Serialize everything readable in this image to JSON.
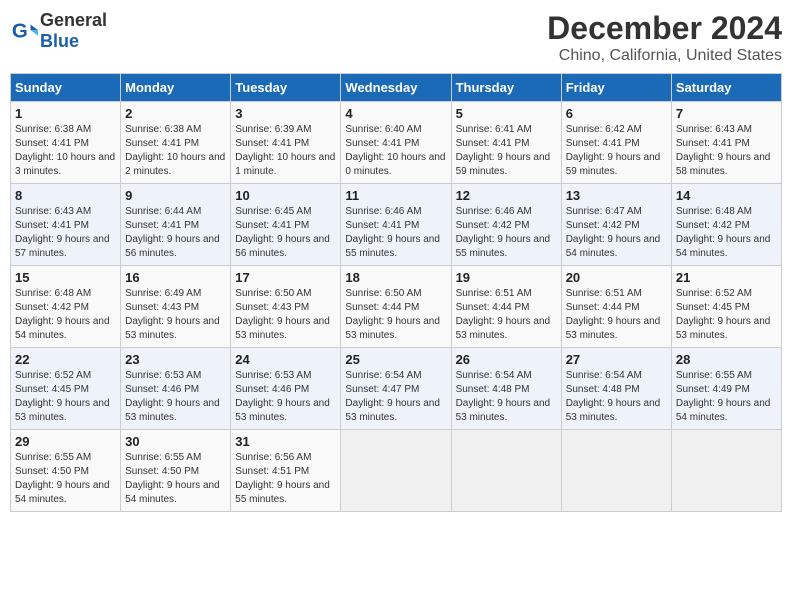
{
  "header": {
    "logo_general": "General",
    "logo_blue": "Blue",
    "month_title": "December 2024",
    "location": "Chino, California, United States"
  },
  "columns": [
    "Sunday",
    "Monday",
    "Tuesday",
    "Wednesday",
    "Thursday",
    "Friday",
    "Saturday"
  ],
  "weeks": [
    [
      {
        "day": "1",
        "sunrise": "Sunrise: 6:38 AM",
        "sunset": "Sunset: 4:41 PM",
        "daylight": "Daylight: 10 hours and 3 minutes."
      },
      {
        "day": "2",
        "sunrise": "Sunrise: 6:38 AM",
        "sunset": "Sunset: 4:41 PM",
        "daylight": "Daylight: 10 hours and 2 minutes."
      },
      {
        "day": "3",
        "sunrise": "Sunrise: 6:39 AM",
        "sunset": "Sunset: 4:41 PM",
        "daylight": "Daylight: 10 hours and 1 minute."
      },
      {
        "day": "4",
        "sunrise": "Sunrise: 6:40 AM",
        "sunset": "Sunset: 4:41 PM",
        "daylight": "Daylight: 10 hours and 0 minutes."
      },
      {
        "day": "5",
        "sunrise": "Sunrise: 6:41 AM",
        "sunset": "Sunset: 4:41 PM",
        "daylight": "Daylight: 9 hours and 59 minutes."
      },
      {
        "day": "6",
        "sunrise": "Sunrise: 6:42 AM",
        "sunset": "Sunset: 4:41 PM",
        "daylight": "Daylight: 9 hours and 59 minutes."
      },
      {
        "day": "7",
        "sunrise": "Sunrise: 6:43 AM",
        "sunset": "Sunset: 4:41 PM",
        "daylight": "Daylight: 9 hours and 58 minutes."
      }
    ],
    [
      {
        "day": "8",
        "sunrise": "Sunrise: 6:43 AM",
        "sunset": "Sunset: 4:41 PM",
        "daylight": "Daylight: 9 hours and 57 minutes."
      },
      {
        "day": "9",
        "sunrise": "Sunrise: 6:44 AM",
        "sunset": "Sunset: 4:41 PM",
        "daylight": "Daylight: 9 hours and 56 minutes."
      },
      {
        "day": "10",
        "sunrise": "Sunrise: 6:45 AM",
        "sunset": "Sunset: 4:41 PM",
        "daylight": "Daylight: 9 hours and 56 minutes."
      },
      {
        "day": "11",
        "sunrise": "Sunrise: 6:46 AM",
        "sunset": "Sunset: 4:41 PM",
        "daylight": "Daylight: 9 hours and 55 minutes."
      },
      {
        "day": "12",
        "sunrise": "Sunrise: 6:46 AM",
        "sunset": "Sunset: 4:42 PM",
        "daylight": "Daylight: 9 hours and 55 minutes."
      },
      {
        "day": "13",
        "sunrise": "Sunrise: 6:47 AM",
        "sunset": "Sunset: 4:42 PM",
        "daylight": "Daylight: 9 hours and 54 minutes."
      },
      {
        "day": "14",
        "sunrise": "Sunrise: 6:48 AM",
        "sunset": "Sunset: 4:42 PM",
        "daylight": "Daylight: 9 hours and 54 minutes."
      }
    ],
    [
      {
        "day": "15",
        "sunrise": "Sunrise: 6:48 AM",
        "sunset": "Sunset: 4:42 PM",
        "daylight": "Daylight: 9 hours and 54 minutes."
      },
      {
        "day": "16",
        "sunrise": "Sunrise: 6:49 AM",
        "sunset": "Sunset: 4:43 PM",
        "daylight": "Daylight: 9 hours and 53 minutes."
      },
      {
        "day": "17",
        "sunrise": "Sunrise: 6:50 AM",
        "sunset": "Sunset: 4:43 PM",
        "daylight": "Daylight: 9 hours and 53 minutes."
      },
      {
        "day": "18",
        "sunrise": "Sunrise: 6:50 AM",
        "sunset": "Sunset: 4:44 PM",
        "daylight": "Daylight: 9 hours and 53 minutes."
      },
      {
        "day": "19",
        "sunrise": "Sunrise: 6:51 AM",
        "sunset": "Sunset: 4:44 PM",
        "daylight": "Daylight: 9 hours and 53 minutes."
      },
      {
        "day": "20",
        "sunrise": "Sunrise: 6:51 AM",
        "sunset": "Sunset: 4:44 PM",
        "daylight": "Daylight: 9 hours and 53 minutes."
      },
      {
        "day": "21",
        "sunrise": "Sunrise: 6:52 AM",
        "sunset": "Sunset: 4:45 PM",
        "daylight": "Daylight: 9 hours and 53 minutes."
      }
    ],
    [
      {
        "day": "22",
        "sunrise": "Sunrise: 6:52 AM",
        "sunset": "Sunset: 4:45 PM",
        "daylight": "Daylight: 9 hours and 53 minutes."
      },
      {
        "day": "23",
        "sunrise": "Sunrise: 6:53 AM",
        "sunset": "Sunset: 4:46 PM",
        "daylight": "Daylight: 9 hours and 53 minutes."
      },
      {
        "day": "24",
        "sunrise": "Sunrise: 6:53 AM",
        "sunset": "Sunset: 4:46 PM",
        "daylight": "Daylight: 9 hours and 53 minutes."
      },
      {
        "day": "25",
        "sunrise": "Sunrise: 6:54 AM",
        "sunset": "Sunset: 4:47 PM",
        "daylight": "Daylight: 9 hours and 53 minutes."
      },
      {
        "day": "26",
        "sunrise": "Sunrise: 6:54 AM",
        "sunset": "Sunset: 4:48 PM",
        "daylight": "Daylight: 9 hours and 53 minutes."
      },
      {
        "day": "27",
        "sunrise": "Sunrise: 6:54 AM",
        "sunset": "Sunset: 4:48 PM",
        "daylight": "Daylight: 9 hours and 53 minutes."
      },
      {
        "day": "28",
        "sunrise": "Sunrise: 6:55 AM",
        "sunset": "Sunset: 4:49 PM",
        "daylight": "Daylight: 9 hours and 54 minutes."
      }
    ],
    [
      {
        "day": "29",
        "sunrise": "Sunrise: 6:55 AM",
        "sunset": "Sunset: 4:50 PM",
        "daylight": "Daylight: 9 hours and 54 minutes."
      },
      {
        "day": "30",
        "sunrise": "Sunrise: 6:55 AM",
        "sunset": "Sunset: 4:50 PM",
        "daylight": "Daylight: 9 hours and 54 minutes."
      },
      {
        "day": "31",
        "sunrise": "Sunrise: 6:56 AM",
        "sunset": "Sunset: 4:51 PM",
        "daylight": "Daylight: 9 hours and 55 minutes."
      },
      null,
      null,
      null,
      null
    ]
  ]
}
